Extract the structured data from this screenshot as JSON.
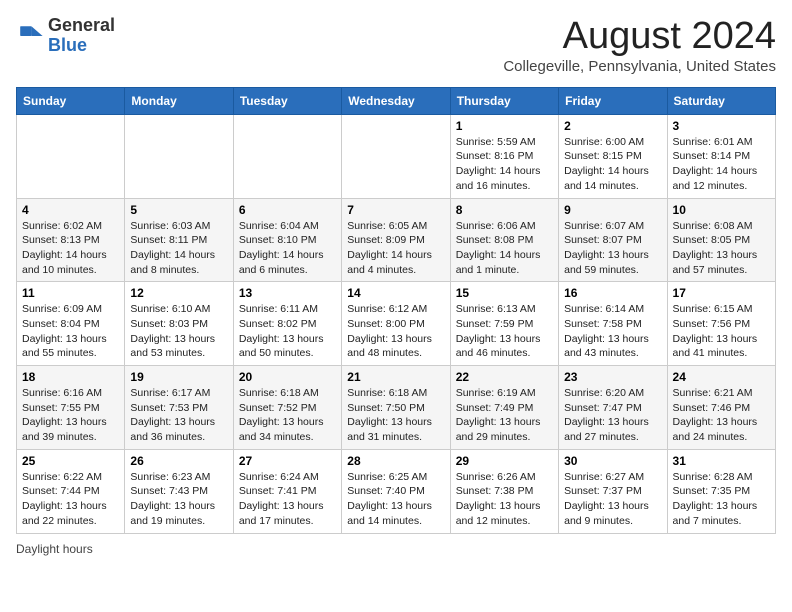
{
  "header": {
    "logo_general": "General",
    "logo_blue": "Blue",
    "title": "August 2024",
    "subtitle": "Collegeville, Pennsylvania, United States"
  },
  "weekdays": [
    "Sunday",
    "Monday",
    "Tuesday",
    "Wednesday",
    "Thursday",
    "Friday",
    "Saturday"
  ],
  "weeks": [
    [
      {
        "day": "",
        "info": ""
      },
      {
        "day": "",
        "info": ""
      },
      {
        "day": "",
        "info": ""
      },
      {
        "day": "",
        "info": ""
      },
      {
        "day": "1",
        "info": "Sunrise: 5:59 AM\nSunset: 8:16 PM\nDaylight: 14 hours\nand 16 minutes."
      },
      {
        "day": "2",
        "info": "Sunrise: 6:00 AM\nSunset: 8:15 PM\nDaylight: 14 hours\nand 14 minutes."
      },
      {
        "day": "3",
        "info": "Sunrise: 6:01 AM\nSunset: 8:14 PM\nDaylight: 14 hours\nand 12 minutes."
      }
    ],
    [
      {
        "day": "4",
        "info": "Sunrise: 6:02 AM\nSunset: 8:13 PM\nDaylight: 14 hours\nand 10 minutes."
      },
      {
        "day": "5",
        "info": "Sunrise: 6:03 AM\nSunset: 8:11 PM\nDaylight: 14 hours\nand 8 minutes."
      },
      {
        "day": "6",
        "info": "Sunrise: 6:04 AM\nSunset: 8:10 PM\nDaylight: 14 hours\nand 6 minutes."
      },
      {
        "day": "7",
        "info": "Sunrise: 6:05 AM\nSunset: 8:09 PM\nDaylight: 14 hours\nand 4 minutes."
      },
      {
        "day": "8",
        "info": "Sunrise: 6:06 AM\nSunset: 8:08 PM\nDaylight: 14 hours\nand 1 minute."
      },
      {
        "day": "9",
        "info": "Sunrise: 6:07 AM\nSunset: 8:07 PM\nDaylight: 13 hours\nand 59 minutes."
      },
      {
        "day": "10",
        "info": "Sunrise: 6:08 AM\nSunset: 8:05 PM\nDaylight: 13 hours\nand 57 minutes."
      }
    ],
    [
      {
        "day": "11",
        "info": "Sunrise: 6:09 AM\nSunset: 8:04 PM\nDaylight: 13 hours\nand 55 minutes."
      },
      {
        "day": "12",
        "info": "Sunrise: 6:10 AM\nSunset: 8:03 PM\nDaylight: 13 hours\nand 53 minutes."
      },
      {
        "day": "13",
        "info": "Sunrise: 6:11 AM\nSunset: 8:02 PM\nDaylight: 13 hours\nand 50 minutes."
      },
      {
        "day": "14",
        "info": "Sunrise: 6:12 AM\nSunset: 8:00 PM\nDaylight: 13 hours\nand 48 minutes."
      },
      {
        "day": "15",
        "info": "Sunrise: 6:13 AM\nSunset: 7:59 PM\nDaylight: 13 hours\nand 46 minutes."
      },
      {
        "day": "16",
        "info": "Sunrise: 6:14 AM\nSunset: 7:58 PM\nDaylight: 13 hours\nand 43 minutes."
      },
      {
        "day": "17",
        "info": "Sunrise: 6:15 AM\nSunset: 7:56 PM\nDaylight: 13 hours\nand 41 minutes."
      }
    ],
    [
      {
        "day": "18",
        "info": "Sunrise: 6:16 AM\nSunset: 7:55 PM\nDaylight: 13 hours\nand 39 minutes."
      },
      {
        "day": "19",
        "info": "Sunrise: 6:17 AM\nSunset: 7:53 PM\nDaylight: 13 hours\nand 36 minutes."
      },
      {
        "day": "20",
        "info": "Sunrise: 6:18 AM\nSunset: 7:52 PM\nDaylight: 13 hours\nand 34 minutes."
      },
      {
        "day": "21",
        "info": "Sunrise: 6:18 AM\nSunset: 7:50 PM\nDaylight: 13 hours\nand 31 minutes."
      },
      {
        "day": "22",
        "info": "Sunrise: 6:19 AM\nSunset: 7:49 PM\nDaylight: 13 hours\nand 29 minutes."
      },
      {
        "day": "23",
        "info": "Sunrise: 6:20 AM\nSunset: 7:47 PM\nDaylight: 13 hours\nand 27 minutes."
      },
      {
        "day": "24",
        "info": "Sunrise: 6:21 AM\nSunset: 7:46 PM\nDaylight: 13 hours\nand 24 minutes."
      }
    ],
    [
      {
        "day": "25",
        "info": "Sunrise: 6:22 AM\nSunset: 7:44 PM\nDaylight: 13 hours\nand 22 minutes."
      },
      {
        "day": "26",
        "info": "Sunrise: 6:23 AM\nSunset: 7:43 PM\nDaylight: 13 hours\nand 19 minutes."
      },
      {
        "day": "27",
        "info": "Sunrise: 6:24 AM\nSunset: 7:41 PM\nDaylight: 13 hours\nand 17 minutes."
      },
      {
        "day": "28",
        "info": "Sunrise: 6:25 AM\nSunset: 7:40 PM\nDaylight: 13 hours\nand 14 minutes."
      },
      {
        "day": "29",
        "info": "Sunrise: 6:26 AM\nSunset: 7:38 PM\nDaylight: 13 hours\nand 12 minutes."
      },
      {
        "day": "30",
        "info": "Sunrise: 6:27 AM\nSunset: 7:37 PM\nDaylight: 13 hours\nand 9 minutes."
      },
      {
        "day": "31",
        "info": "Sunrise: 6:28 AM\nSunset: 7:35 PM\nDaylight: 13 hours\nand 7 minutes."
      }
    ]
  ],
  "footer": {
    "note": "Daylight hours"
  }
}
